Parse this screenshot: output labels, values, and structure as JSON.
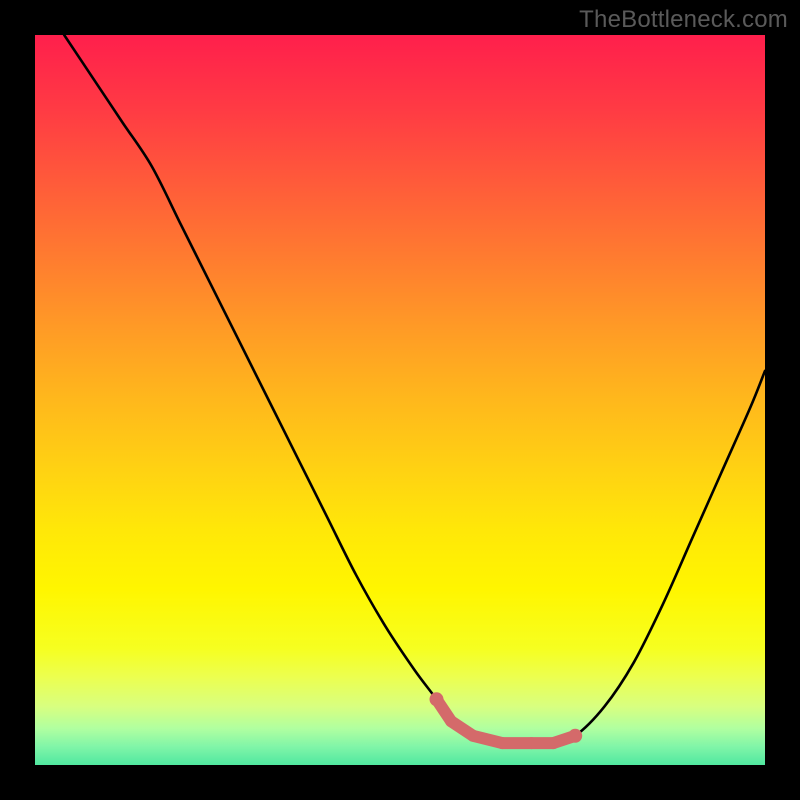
{
  "watermark": {
    "text": "TheBottleneck.com"
  },
  "plot": {
    "gradient_stops": [
      {
        "offset": 0.0,
        "color": "#ff1f4c"
      },
      {
        "offset": 0.1,
        "color": "#ff3a44"
      },
      {
        "offset": 0.2,
        "color": "#ff5a3a"
      },
      {
        "offset": 0.3,
        "color": "#ff7a30"
      },
      {
        "offset": 0.4,
        "color": "#ff9a26"
      },
      {
        "offset": 0.5,
        "color": "#ffb81c"
      },
      {
        "offset": 0.6,
        "color": "#ffd312"
      },
      {
        "offset": 0.68,
        "color": "#ffe808"
      },
      {
        "offset": 0.76,
        "color": "#fff600"
      },
      {
        "offset": 0.84,
        "color": "#f6ff20"
      },
      {
        "offset": 0.88,
        "color": "#ecff50"
      },
      {
        "offset": 0.92,
        "color": "#d8ff80"
      },
      {
        "offset": 0.95,
        "color": "#b0ffa0"
      },
      {
        "offset": 0.975,
        "color": "#80f5a8"
      },
      {
        "offset": 1.0,
        "color": "#50e8a0"
      }
    ]
  },
  "chart_data": {
    "type": "line",
    "title": "",
    "xlabel": "",
    "ylabel": "",
    "xlim": [
      0,
      100
    ],
    "ylim": [
      0,
      100
    ],
    "grid": false,
    "legend": false,
    "series": [
      {
        "name": "curve",
        "x": [
          4,
          8,
          12,
          16,
          20,
          24,
          28,
          32,
          36,
          40,
          44,
          48,
          52,
          55,
          57,
          60,
          64,
          68,
          71,
          74,
          78,
          82,
          86,
          90,
          94,
          98,
          100
        ],
        "y": [
          100,
          94,
          88,
          82,
          74,
          66,
          58,
          50,
          42,
          34,
          26,
          19,
          13,
          9,
          6,
          4,
          3,
          3,
          3,
          4,
          8,
          14,
          22,
          31,
          40,
          49,
          54
        ]
      }
    ],
    "overlay": {
      "name": "highlight",
      "color": "#d46a6a",
      "x": [
        55,
        57,
        60,
        64,
        68,
        71,
        74
      ],
      "y": [
        9,
        6,
        4,
        3,
        3,
        3,
        4
      ]
    }
  }
}
